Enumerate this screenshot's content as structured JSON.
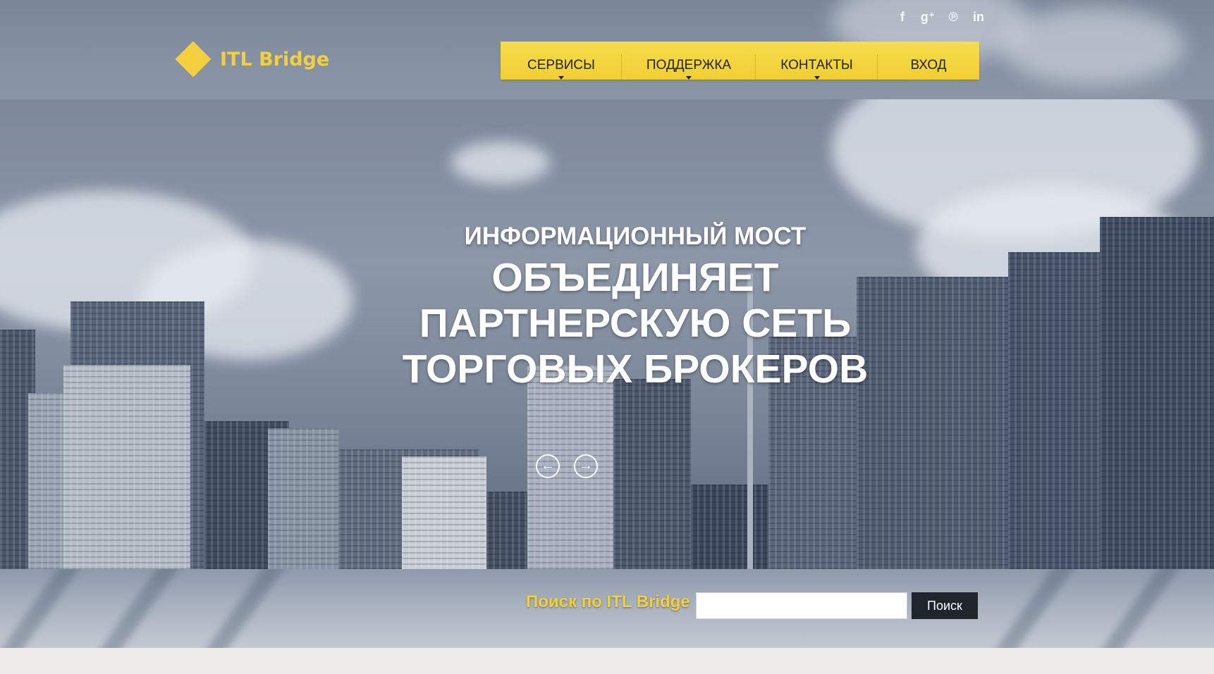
{
  "brand": {
    "name": "ITL Bridge",
    "accent_color": "#f3cf3f"
  },
  "social": [
    {
      "icon": "facebook-icon",
      "glyph": "f"
    },
    {
      "icon": "google-plus-icon",
      "glyph": "g⁺"
    },
    {
      "icon": "pinterest-icon",
      "glyph": "℗"
    },
    {
      "icon": "linkedin-icon",
      "glyph": "in"
    }
  ],
  "nav": {
    "items": [
      {
        "label": "СЕРВИСЫ",
        "has_dropdown": true
      },
      {
        "label": "ПОДДЕРЖКА",
        "has_dropdown": true
      },
      {
        "label": "КОНТАКТЫ",
        "has_dropdown": true
      },
      {
        "label": "ВХОД",
        "has_dropdown": false
      }
    ]
  },
  "hero": {
    "subtitle": "ИНФОРМАЦИОННЫЙ МОСТ",
    "title_lines": [
      "ОБЪЕДИНЯЕТ",
      "ПАРТНЕРСКУЮ СЕТЬ",
      "ТОРГОВЫХ БРОКЕРОВ"
    ],
    "prev_glyph": "←",
    "next_glyph": "→"
  },
  "search": {
    "label": "Поиск по ITL Bridge",
    "value": "",
    "placeholder": "",
    "button_label": "Поиск"
  }
}
